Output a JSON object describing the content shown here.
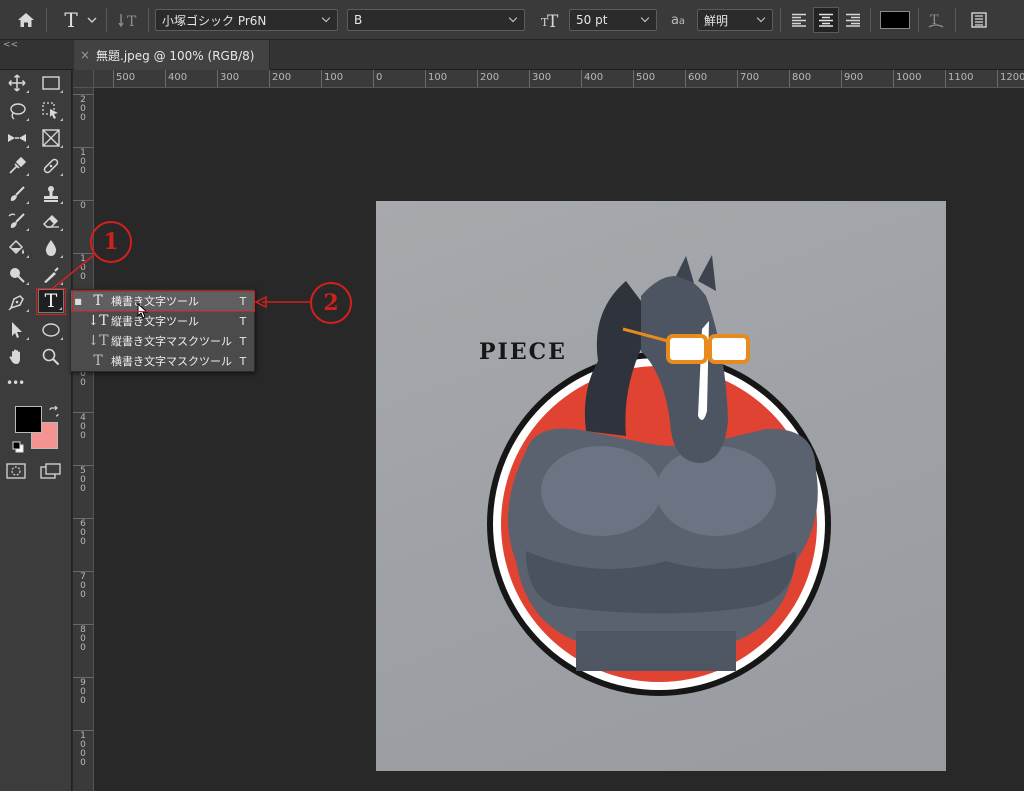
{
  "options_bar": {
    "font_family": "小塚ゴシック Pr6N",
    "font_style": "B",
    "font_size": "50 pt",
    "anti_alias": "鮮明",
    "text_color": "#000000",
    "icons": [
      "home-icon",
      "type-tool-icon",
      "text-orientation-icon",
      "font-size-icon",
      "anti-alias-icon",
      "align-left-icon",
      "align-center-icon",
      "align-right-icon",
      "warp-text-icon",
      "character-panel-icon"
    ]
  },
  "collapse_label": "<<",
  "tab": {
    "close": "×",
    "title": "無題.jpeg @ 100% (RGB/8)"
  },
  "ruler_top_labels": [
    "500",
    "400",
    "300",
    "200",
    "100",
    "0",
    "100",
    "200",
    "300",
    "400",
    "500",
    "600",
    "700",
    "800",
    "900",
    "1000",
    "1100",
    "1200"
  ],
  "ruler_left_labels": [
    "200",
    "100",
    "0",
    "100",
    "200",
    "300",
    "400",
    "500",
    "600",
    "700",
    "800",
    "900",
    "1000"
  ],
  "toolbar": {
    "more_label": "•••",
    "foreground_color": "#000000",
    "background_color": "#f59393"
  },
  "flyout": {
    "items": [
      {
        "bullet": "■",
        "icon": "T",
        "label": "横書き文字ツール",
        "shortcut": "T"
      },
      {
        "bullet": "",
        "icon": "↓T",
        "label": "縦書き文字ツール",
        "shortcut": "T"
      },
      {
        "bullet": "",
        "icon": "↓T",
        "label": "縦書き文字マスクツール",
        "shortcut": "T"
      },
      {
        "bullet": "",
        "icon": "T",
        "label": "横書き文字マスクツール",
        "shortcut": "T"
      }
    ]
  },
  "callouts": {
    "one": "1",
    "two": "2"
  },
  "canvas": {
    "piece_text": "PIECE",
    "accent": "#e04332",
    "highlight": "#d2211c"
  }
}
